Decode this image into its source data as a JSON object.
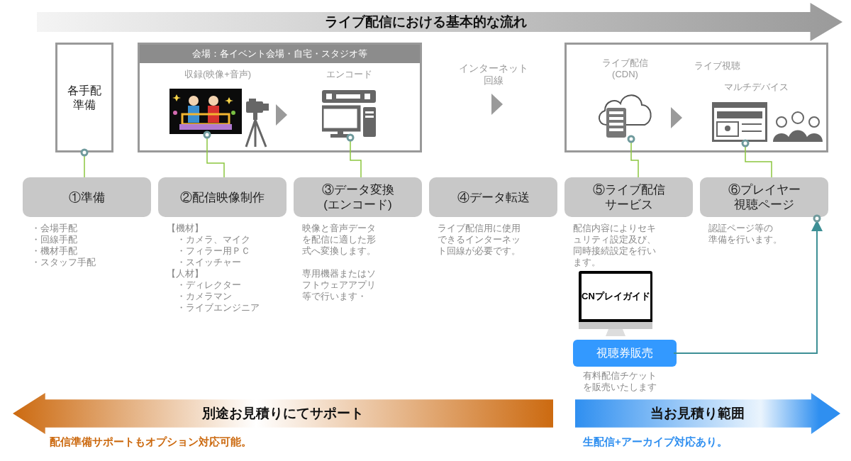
{
  "banner": {
    "title": "ライブ配信における基本的な流れ"
  },
  "prep_box": {
    "lines": [
      "各手配",
      "準備"
    ]
  },
  "venue": {
    "header": "会場：各イベント会場・自宅・スタジオ等",
    "recording_label": "収録(映像+音声)",
    "encode_label": "エンコード"
  },
  "network": {
    "lines": [
      "インターネット",
      "回線"
    ]
  },
  "viewing": {
    "cdn_lines": [
      "ライブ配信",
      "(CDN)"
    ],
    "watch_label": "ライブ視聴",
    "device_label": "マルチデバイス"
  },
  "steps": [
    {
      "title": [
        "①準備"
      ],
      "notes": [
        {
          "kind": "list",
          "items": [
            "・会場手配",
            "・回線手配",
            "・機材手配",
            "・スタッフ手配"
          ]
        }
      ]
    },
    {
      "title": [
        "②配信映像制作"
      ],
      "notes": [
        {
          "kind": "group",
          "heading": "【機材】",
          "items": [
            "・カメラ、マイク",
            "・フィラー用ＰＣ",
            "・スイッチャー"
          ]
        },
        {
          "kind": "group",
          "heading": "【人材】",
          "items": [
            "・ディレクター",
            "・カメラマン",
            "・ライブエンジニア"
          ]
        }
      ]
    },
    {
      "title": [
        "③データ変換",
        "(エンコード)"
      ],
      "notes": [
        {
          "kind": "paragraph",
          "lines": [
            "映像と音声データ",
            "を配信に適した形",
            "式へ変換します。"
          ]
        },
        {
          "kind": "paragraph",
          "lines": [
            "専用機器またはソ",
            "フトウェアアプリ",
            "等で行います・"
          ]
        }
      ]
    },
    {
      "title": [
        "④データ転送"
      ],
      "notes": [
        {
          "kind": "paragraph",
          "lines": [
            "ライブ配信用に使用",
            "できるインターネッ",
            "ト回線が必要です。"
          ]
        }
      ]
    },
    {
      "title": [
        "⑤ライブ配信",
        "サービス"
      ],
      "notes": [
        {
          "kind": "paragraph",
          "lines": [
            "配信内容によりセキ",
            "ュリティ設定及び、",
            "同時接続設定を行い",
            "ます。"
          ]
        }
      ],
      "ticket": {
        "logo": "CNプレイガイド",
        "button": "視聴券販売",
        "note_lines": [
          "有料配信チケット",
          "を販売いたします"
        ]
      }
    },
    {
      "title": [
        "⑥プレイヤー",
        "視聴ページ"
      ],
      "notes": [
        {
          "kind": "paragraph",
          "lines": [
            "認証ページ等の",
            "準備を行います。"
          ]
        }
      ]
    }
  ],
  "scope": [
    {
      "kind": "left",
      "title": "別途お見積りにてサポート",
      "note": "配信準備サポートもオプション対応可能。",
      "color": "#cc6a10"
    },
    {
      "kind": "right",
      "title": "当お見積り範囲",
      "note": "生配信+アーカイブ対応あり。",
      "color": "#2f8ff0"
    }
  ]
}
